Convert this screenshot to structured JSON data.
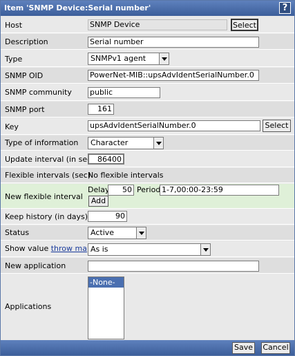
{
  "title": "Item 'SNMP Device:Serial number'",
  "help_label": "?",
  "host": {
    "label": "Host",
    "value": "SNMP Device",
    "button": "Select"
  },
  "description": {
    "label": "Description",
    "value": "Serial number"
  },
  "type": {
    "label": "Type",
    "value": "SNMPv1 agent"
  },
  "snmp_oid": {
    "label": "SNMP OID",
    "value": "PowerNet-MIB::upsAdvIdentSerialNumber.0"
  },
  "snmp_community": {
    "label": "SNMP community",
    "value": "public"
  },
  "snmp_port": {
    "label": "SNMP port",
    "value": "161"
  },
  "key": {
    "label": "Key",
    "value": "upsAdvIdentSerialNumber.0",
    "button": "Select"
  },
  "type_of_information": {
    "label": "Type of information",
    "value": "Character"
  },
  "update_interval": {
    "label": "Update interval (in sec)",
    "value": "86400"
  },
  "flexible_intervals": {
    "label": "Flexible intervals (sec)",
    "value": "No flexible intervals"
  },
  "new_flexible_interval": {
    "label": "New flexible interval",
    "delay_label": "Delay",
    "delay_value": "50",
    "period_label": "Period",
    "period_value": "1-7,00:00-23:59",
    "add_button": "Add"
  },
  "keep_history": {
    "label": "Keep history (in days)",
    "value": "90"
  },
  "status": {
    "label": "Status",
    "value": "Active"
  },
  "show_value": {
    "label": "Show value",
    "link": "throw map",
    "value": "As is"
  },
  "new_application": {
    "label": "New application",
    "value": ""
  },
  "applications": {
    "label": "Applications",
    "options": [
      "-None-"
    ]
  },
  "footer": {
    "save": "Save",
    "cancel": "Cancel"
  },
  "colors": {
    "title_bar": "#4a6dab",
    "row_bg": "#e9e9e9",
    "highlight_row": "#dff0d8",
    "list_selection": "#4a6fb0"
  }
}
